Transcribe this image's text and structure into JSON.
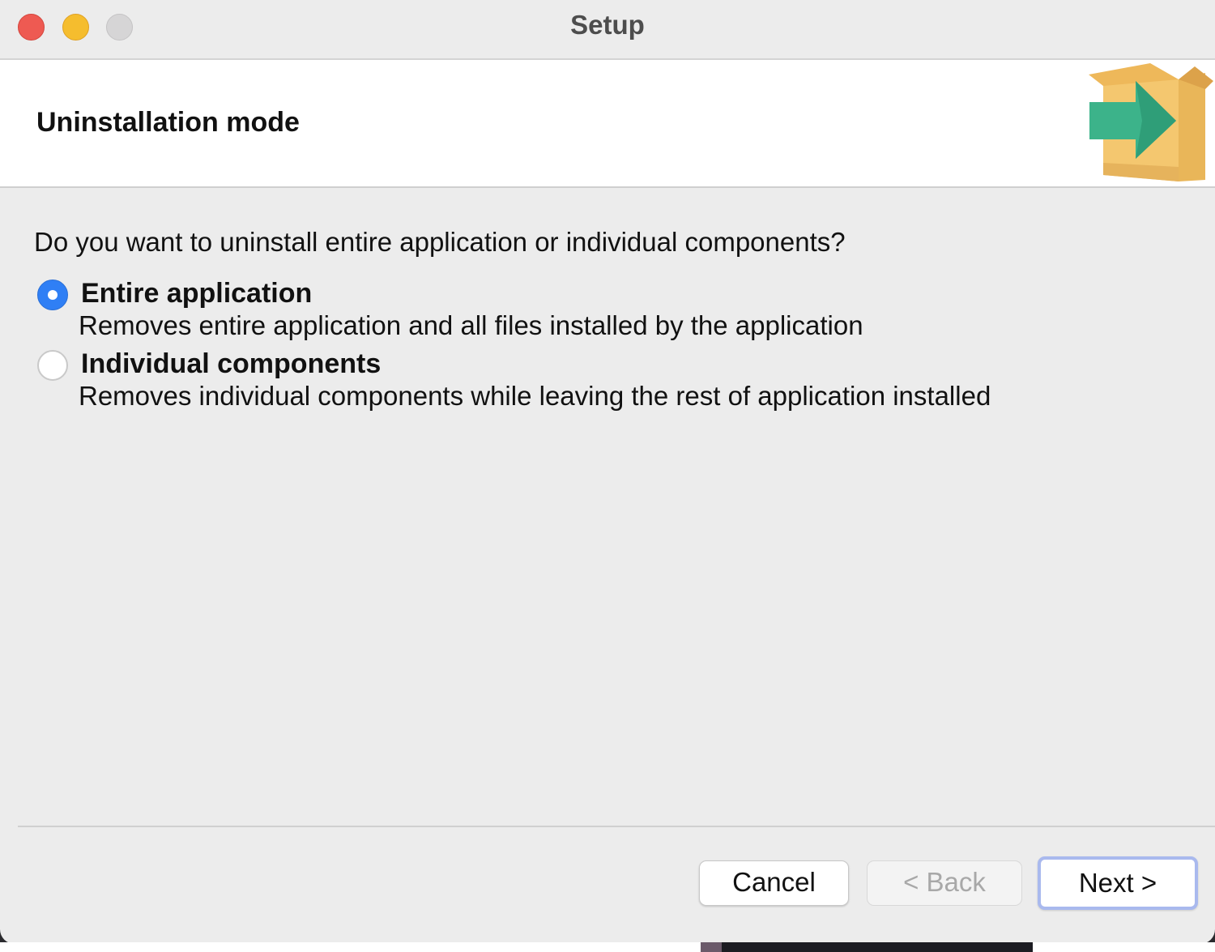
{
  "window": {
    "title": "Setup"
  },
  "header": {
    "title": "Uninstallation mode",
    "icon": "package-arrow-icon"
  },
  "content": {
    "question": "Do you want to uninstall entire application or individual components?",
    "options": [
      {
        "label": "Entire application",
        "description": "Removes entire application and all files installed by the application",
        "selected": true
      },
      {
        "label": "Individual components",
        "description": "Removes individual components while leaving the rest of application installed",
        "selected": false
      }
    ]
  },
  "buttons": {
    "cancel": "Cancel",
    "back": "< Back",
    "next": "Next >",
    "back_enabled": false
  },
  "colors": {
    "accent": "#2f7ff5",
    "close": "#ee5a52",
    "minimize": "#f5bd2e",
    "zoom": "#d6d5d6",
    "box": "#f2c46d",
    "arrow": "#3cb38a"
  }
}
